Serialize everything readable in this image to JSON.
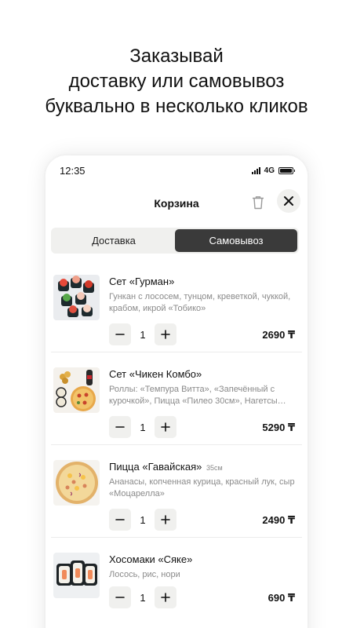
{
  "headline": {
    "line1": "Заказывай",
    "line2": "доставку или самовывоз",
    "line3": "буквально в несколько кликов"
  },
  "statusbar": {
    "time": "12:35",
    "network": "4G"
  },
  "cart": {
    "title": "Корзина",
    "trash_icon": "trash-icon",
    "close_icon": "close-icon"
  },
  "tabs": [
    {
      "label": "Доставка",
      "active": false
    },
    {
      "label": "Самовывоз",
      "active": true
    }
  ],
  "items": [
    {
      "name": "Сет «Гурман»",
      "size": "",
      "description": "Гункан с лососем, тунцом, креветкой, чуккой, крабом, икрой «Тобико»",
      "quantity": "1",
      "price": "2690 ₸"
    },
    {
      "name": "Сет «Чикен Комбо»",
      "size": "",
      "description": "Роллы: «Темпура Витта», «Запечённый с курочкой», Пицца «Пилео 30см», Нагетсы…",
      "quantity": "1",
      "price": "5290 ₸"
    },
    {
      "name": "Пицца «Гавайская»",
      "size": "35см",
      "description": "Ананасы, копченная курица, красный лук, сыр «Моцарелла»",
      "quantity": "1",
      "price": "2490 ₸"
    },
    {
      "name": "Хосомаки «Сяке»",
      "size": "",
      "description": "Лосось, рис, нори",
      "quantity": "1",
      "price": "690 ₸"
    }
  ],
  "stepper": {
    "minus_icon": "minus-icon",
    "plus_icon": "plus-icon"
  }
}
